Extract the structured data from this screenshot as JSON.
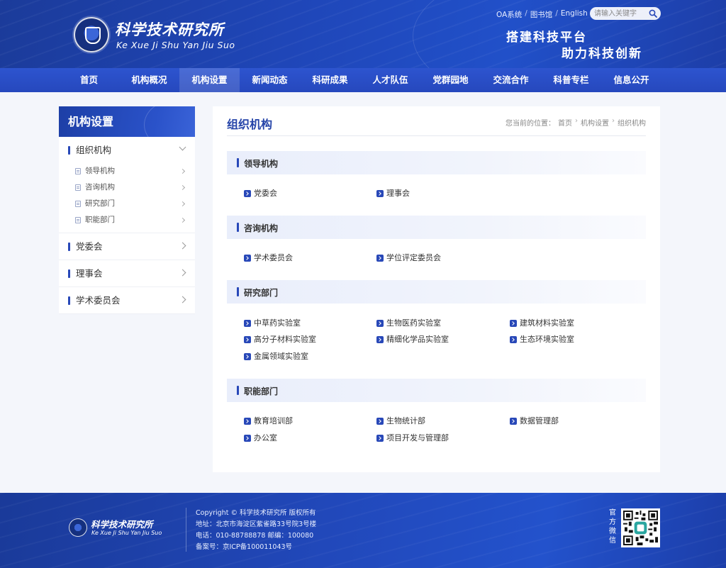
{
  "header": {
    "logo_cn": "科学技术研究所",
    "logo_en": "Ke Xue Ji Shu Yan Jiu Suo",
    "links": [
      "OA系统",
      "图书馆",
      "English"
    ],
    "link_sep": "/",
    "search_placeholder": "请输入关键字",
    "slogan_line1": "搭建科技平台",
    "slogan_line2": "助力科技创新"
  },
  "nav": {
    "items": [
      "首页",
      "机构概况",
      "机构设置",
      "新闻动态",
      "科研成果",
      "人才队伍",
      "党群园地",
      "交流合作",
      "科普专栏",
      "信息公开"
    ],
    "active_index": 2
  },
  "sidebar": {
    "title": "机构设置",
    "groups": [
      {
        "label": "组织机构",
        "expanded": true,
        "children": [
          "领导机构",
          "咨询机构",
          "研究部门",
          "职能部门"
        ]
      },
      {
        "label": "党委会",
        "expanded": false
      },
      {
        "label": "理事会",
        "expanded": false
      },
      {
        "label": "学术委员会",
        "expanded": false
      }
    ]
  },
  "main": {
    "title": "组织机构",
    "breadcrumb": {
      "prefix": "您当前的位置：",
      "items": [
        "首页",
        "机构设置",
        "组织机构"
      ],
      "sep": "›"
    },
    "sections": [
      {
        "title": "领导机构",
        "items": [
          "党委会",
          "理事会"
        ]
      },
      {
        "title": "咨询机构",
        "items": [
          "学术委员会",
          "学位评定委员会"
        ]
      },
      {
        "title": "研究部门",
        "items": [
          "中草药实验室",
          "生物医药实验室",
          "建筑材料实验室",
          "高分子材料实验室",
          "精细化学品实验室",
          "生态环境实验室",
          "金属领域实验室"
        ]
      },
      {
        "title": "职能部门",
        "items": [
          "教育培训部",
          "生物统计部",
          "数据管理部",
          "办公室",
          "项目开发与管理部"
        ]
      }
    ]
  },
  "footer": {
    "logo_cn": "科学技术研究所",
    "logo_en": "Ke Xue Ji Shu Yan Jiu Suo",
    "copyright": "Copyright © 科学技术研究所 版权所有",
    "address": "地址：北京市海淀区紫雀路33号院3号楼",
    "phone": "电话：010-88788878   邮编：100080",
    "icp": "备案号：京ICP备100011043号",
    "qr_label": "官方微信"
  },
  "colors": {
    "primary": "#2848b8",
    "title": "#2443a8",
    "header_bg": "#1f46b8"
  }
}
